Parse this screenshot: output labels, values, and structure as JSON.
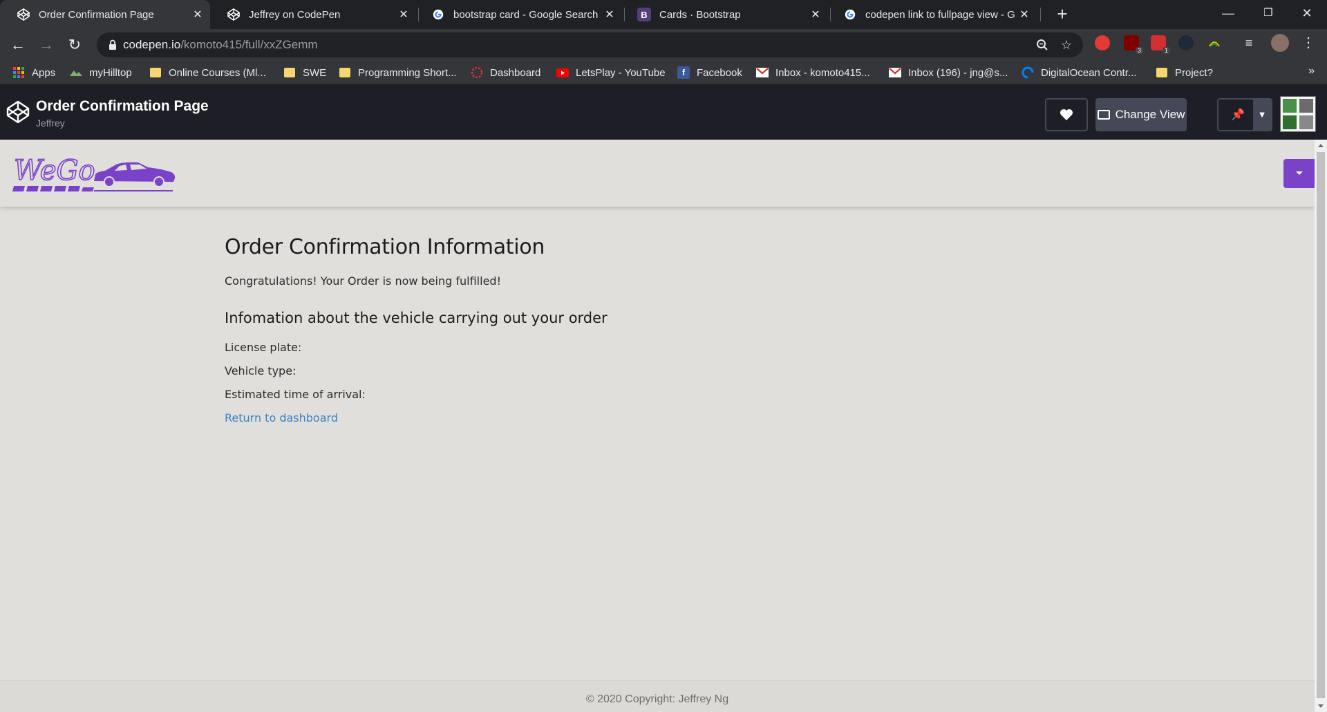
{
  "browser": {
    "tabs": [
      {
        "label": "Order Confirmation Page",
        "icon": "codepen-icon",
        "active": true
      },
      {
        "label": "Jeffrey on CodePen",
        "icon": "codepen-icon",
        "active": false
      },
      {
        "label": "bootstrap card - Google Search",
        "icon": "google-icon",
        "active": false
      },
      {
        "label": "Cards · Bootstrap",
        "icon": "bootstrap-icon",
        "active": false
      },
      {
        "label": "codepen link to fullpage view - G",
        "icon": "google-icon",
        "active": false
      }
    ],
    "url_host": "codepen.io",
    "url_path": "/komoto415/full/xxZGemm",
    "extension_badges": [
      "3",
      "1"
    ],
    "bookmarks": [
      {
        "label": "Apps",
        "icon": "apps-grid-icon"
      },
      {
        "label": "myHilltop",
        "icon": "hilltop-icon"
      },
      {
        "label": "Online Courses (Ml...",
        "icon": "folder-icon"
      },
      {
        "label": "SWE",
        "icon": "folder-icon"
      },
      {
        "label": "Programming Short...",
        "icon": "folder-icon"
      },
      {
        "label": "Dashboard",
        "icon": "dashboard-icon"
      },
      {
        "label": "LetsPlay - YouTube",
        "icon": "youtube-icon"
      },
      {
        "label": "Facebook",
        "icon": "facebook-icon"
      },
      {
        "label": "Inbox - komoto415...",
        "icon": "gmail-icon"
      },
      {
        "label": "Inbox (196) - jng@s...",
        "icon": "gmail-icon"
      },
      {
        "label": "DigitalOcean Contr...",
        "icon": "digitalocean-icon"
      },
      {
        "label": "Project?",
        "icon": "folder-icon"
      }
    ],
    "bookmarks_more": "»"
  },
  "codepen": {
    "title": "Order Confirmation Page",
    "author": "Jeffrey",
    "change_view_label": "Change View"
  },
  "site": {
    "brand_text": "WeGo",
    "brand_color": "#7a42c9",
    "heading": "Order Confirmation Information",
    "message": "Congratulations! Your Order is now being fulfilled!",
    "subheading": "Infomation about the vehicle carrying out your order",
    "fields": {
      "license_plate": "License plate:",
      "vehicle_type": "Vehicle type:",
      "eta": "Estimated time of arrival:"
    },
    "return_link": "Return to dashboard",
    "footer": "© 2020 Copyright: Jeffrey Ng"
  }
}
